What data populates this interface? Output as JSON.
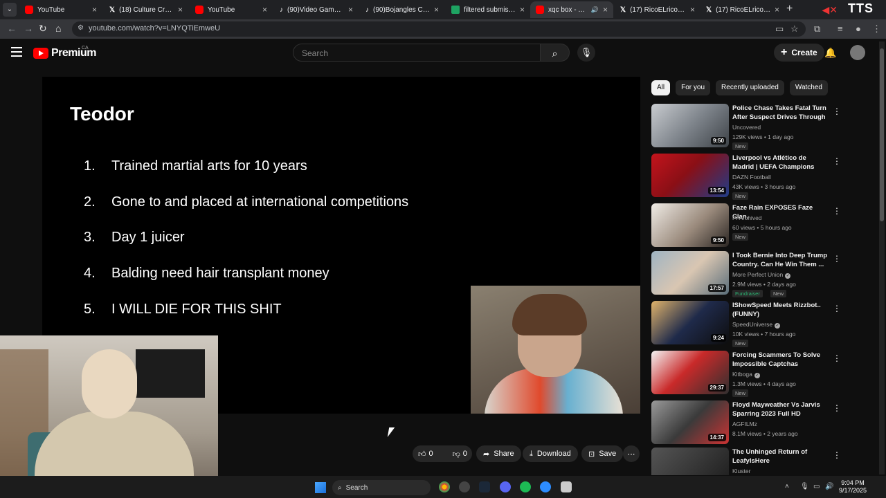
{
  "browser": {
    "tabs": [
      {
        "title": "YouTube",
        "favicon": "youtube-icon",
        "active": false
      },
      {
        "title": "(18) Culture Crave 🚨",
        "favicon": "x-icon",
        "active": false
      },
      {
        "title": "YouTube",
        "favicon": "youtube-icon",
        "active": false
      },
      {
        "title": "(90)Video Gamw Mis",
        "favicon": "tiktok-icon",
        "active": false
      },
      {
        "title": "(90)Bojangles Custo",
        "favicon": "tiktok-icon",
        "active": false
      },
      {
        "title": "filtered submissions",
        "favicon": "sheets-icon",
        "active": false
      },
      {
        "title": "xqc box - YouTub",
        "favicon": "youtube-icon",
        "active": true
      },
      {
        "title": "(17) RicoELricoo on X",
        "favicon": "x-icon",
        "active": false
      },
      {
        "title": "(17) RicoELricoo (@R",
        "favicon": "x-icon",
        "active": false
      }
    ],
    "url": "youtube.com/watch?v=LNYQTiEmweU",
    "overlay_text": "TTS"
  },
  "youtube": {
    "logo_text": "Premium",
    "country": "CA",
    "search_placeholder": "Search",
    "create_label": "Create"
  },
  "video": {
    "slide_title": "Teodor",
    "slide_items": [
      {
        "num": "1.",
        "text": "Trained martial arts for 10 years"
      },
      {
        "num": "2.",
        "text": "Gone to and placed at international competitions"
      },
      {
        "num": "3.",
        "text": "Day 1 juicer"
      },
      {
        "num": "4.",
        "text": "Balding need hair transplant money"
      },
      {
        "num": "5.",
        "text": "I WILL DIE FOR THIS SHIT"
      }
    ]
  },
  "actions": {
    "likes": "0",
    "dislikes": "0",
    "share": "Share",
    "download": "Download",
    "save": "Save"
  },
  "sidebar": {
    "chips": [
      "All",
      "For you",
      "Recently uploaded",
      "Watched"
    ],
    "active_chip": "All",
    "recommendations": [
      {
        "title": "Police Chase Takes Fatal Turn After Suspect Drives Through ...",
        "channel": "Uncovered",
        "meta": "129K views • 1 day ago",
        "duration": "9:50",
        "badges": [
          "New"
        ],
        "verified": false
      },
      {
        "title": "Liverpool vs Atlético de Madrid | UEFA Champions League ...",
        "channel": "DAZN Football",
        "meta": "43K views • 3 hours ago",
        "duration": "13:54",
        "badges": [
          "New"
        ],
        "verified": false
      },
      {
        "title": "Faze Rain EXPOSES Faze Clan.",
        "channel": "Pi Archived",
        "meta": "60 views • 5 hours ago",
        "duration": "9:50",
        "badges": [
          "New"
        ],
        "verified": false
      },
      {
        "title": "I Took Bernie Into Deep Trump Country. Can He Win Them ...",
        "channel": "More Perfect Union",
        "meta": "2.9M views • 2 days ago",
        "duration": "17:57",
        "badges": [
          "Fundraiser",
          "New"
        ],
        "verified": true
      },
      {
        "title": "IShowSpeed Meets Rizzbot.. (FUNNY)",
        "channel": "SpeedUniverse",
        "meta": "10K views • 7 hours ago",
        "duration": "9:24",
        "badges": [
          "New"
        ],
        "verified": true
      },
      {
        "title": "Forcing Scammers To Solve Impossible Captchas",
        "channel": "Kitboga",
        "meta": "1.3M views • 4 days ago",
        "duration": "29:37",
        "badges": [
          "New"
        ],
        "verified": true
      },
      {
        "title": "Floyd Mayweather Vs Jarvis Sparring 2023 Full HD",
        "channel": "AGFILMz",
        "meta": "8.1M views • 2 years ago",
        "duration": "14:37",
        "badges": [],
        "verified": false
      },
      {
        "title": "The Unhinged Return of LeafyIsHere",
        "channel": "Kluster",
        "meta": "",
        "duration": "",
        "badges": [],
        "verified": false
      }
    ]
  },
  "taskbar": {
    "search_label": "Search",
    "time": "9:04 PM",
    "date": "9/17/2025"
  },
  "colors": {
    "youtube_red": "#ff0000",
    "background": "#0f0f0f",
    "chip_bg": "#272727"
  }
}
